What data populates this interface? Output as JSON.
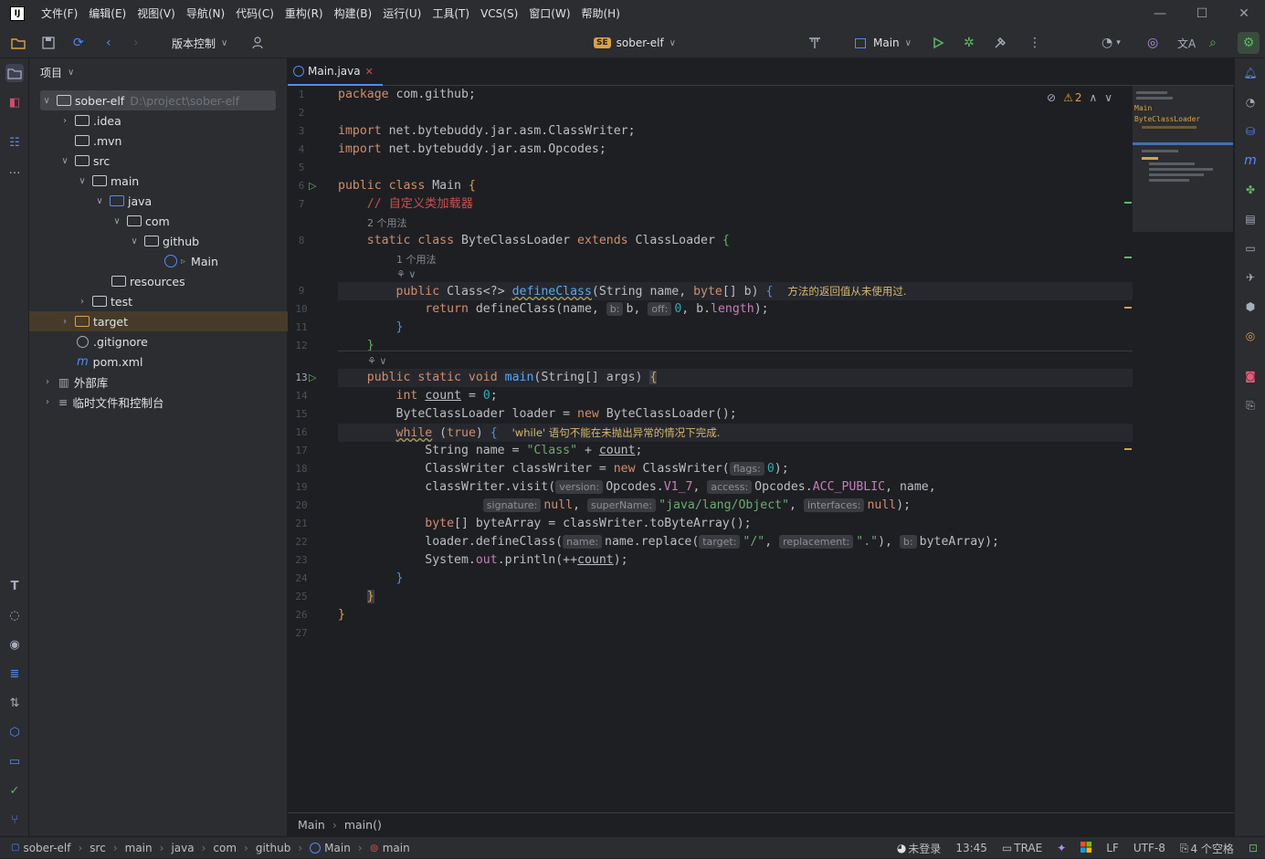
{
  "menu": [
    "文件(F)",
    "编辑(E)",
    "视图(V)",
    "导航(N)",
    "代码(C)",
    "重构(R)",
    "构建(B)",
    "运行(U)",
    "工具(T)",
    "VCS(S)",
    "窗口(W)",
    "帮助(H)"
  ],
  "toolbar": {
    "vcs_label": "版本控制",
    "project_badge": "SE",
    "project_name": "sober-elf",
    "run_config": "Main"
  },
  "project_panel": {
    "title": "项目",
    "tree": [
      {
        "label": "sober-elf",
        "path": "D:\\project\\sober-elf"
      },
      {
        "label": ".idea"
      },
      {
        "label": ".mvn"
      },
      {
        "label": "src"
      },
      {
        "label": "main"
      },
      {
        "label": "java"
      },
      {
        "label": "com"
      },
      {
        "label": "github"
      },
      {
        "label": "Main"
      },
      {
        "label": "resources"
      },
      {
        "label": "test"
      },
      {
        "label": "target"
      },
      {
        "label": ".gitignore"
      },
      {
        "label": "pom.xml"
      },
      {
        "label": "外部库"
      },
      {
        "label": "临时文件和控制台"
      }
    ]
  },
  "editor": {
    "tab_name": "Main.java",
    "warnings_count": "2",
    "usages_2": "2 个用法",
    "usages_1": "1 个用法",
    "comment": "// 自定义类加载器",
    "warn_defineClass": "方法的返回值从未使用过.",
    "warn_while": "'while' 语句不能在未抛出异常的情况下完成.",
    "line_numbers": [
      "1",
      "2",
      "3",
      "4",
      "5",
      "6",
      "7",
      "8",
      "9",
      "10",
      "11",
      "12",
      "13",
      "14",
      "15",
      "16",
      "17",
      "18",
      "19",
      "20",
      "21",
      "22",
      "23",
      "24",
      "25",
      "26",
      "27"
    ],
    "minimap_labels": [
      "Main",
      "ByteClassLoader"
    ]
  },
  "breadcrumb": {
    "cls": "Main",
    "method": "main()"
  },
  "status": {
    "path": [
      "sober-elf",
      "src",
      "main",
      "java",
      "com",
      "github",
      "Main",
      "main"
    ],
    "login": "未登录",
    "position": "13:45",
    "trae": "TRAE",
    "line_sep": "LF",
    "encoding": "UTF-8",
    "indent": "4 个空格"
  },
  "colors": {
    "accent": "#548af7",
    "keyword": "#cf8e6d",
    "string": "#6aab73",
    "number": "#2aacb8",
    "function": "#56a8f5",
    "warning": "#d7b86d",
    "bg": "#1e1f22",
    "panel": "#2b2d30"
  }
}
